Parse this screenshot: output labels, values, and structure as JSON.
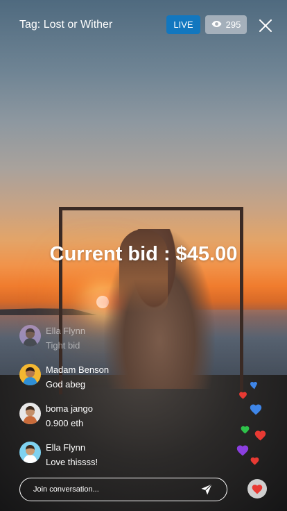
{
  "header": {
    "tag_title": "Tag: Lost or Wither",
    "live_label": "LIVE",
    "viewer_count": "295",
    "viewer_icon": "eye-icon",
    "close_icon": "close-icon"
  },
  "bid": {
    "text": "Current bid : $45.00"
  },
  "chat": {
    "messages": [
      {
        "name": "Ella Flynn",
        "text": "Tight bid",
        "faded": true
      },
      {
        "name": "Madam Benson",
        "text": "God abeg"
      },
      {
        "name": "boma jango",
        "text": "0.900 eth"
      },
      {
        "name": "Ella Flynn",
        "text": "Love thissss!"
      }
    ]
  },
  "compose": {
    "placeholder": "Join conversation...",
    "send_icon": "send-icon"
  },
  "like": {
    "icon": "heart-icon"
  },
  "colors": {
    "live_badge": "#1277bf",
    "heart_red": "#e83a33",
    "heart_blue": "#3f86e8",
    "heart_green": "#2ec24a",
    "heart_purple": "#8b3fe0"
  }
}
